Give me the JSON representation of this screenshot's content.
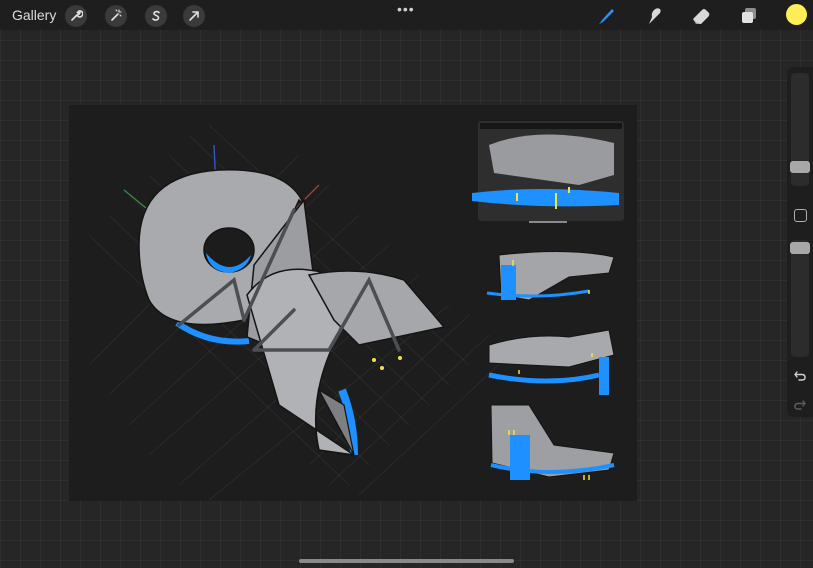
{
  "topbar": {
    "gallery_label": "Gallery",
    "left_tools": [
      "wrench-icon",
      "magic-wand-icon",
      "selection-s-icon",
      "transform-arrow-icon"
    ],
    "more_label": "•••",
    "right_tools": [
      "brush-icon",
      "smudge-icon",
      "eraser-icon",
      "layers-icon"
    ],
    "active_tool": "brush-icon",
    "current_color": "#ffee58"
  },
  "colors": {
    "accent_blue": "#2f8fff",
    "water_blue": "#1e90ff",
    "figure_yellow": "#f2e24a",
    "shape_gray": "#a9aaae"
  },
  "sidebar": {
    "brush_size_level": 0.3,
    "opacity_level": 0.6
  }
}
